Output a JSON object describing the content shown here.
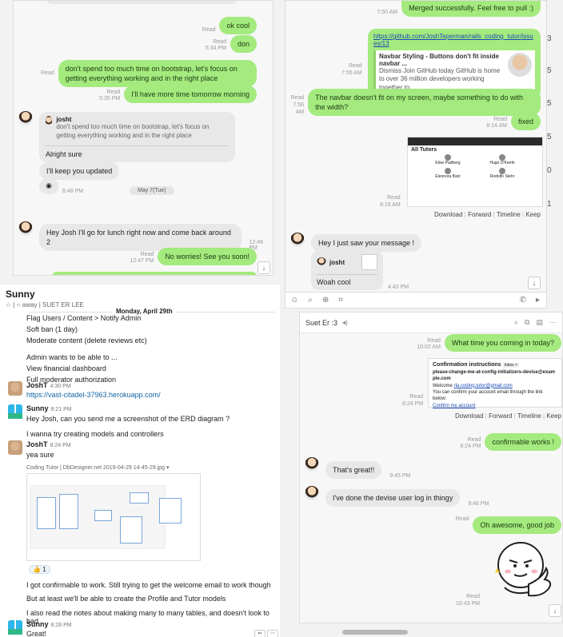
{
  "w1": {
    "msgs": [
      {
        "meta": "Read",
        "text": "ok cool"
      },
      {
        "meta": "Read",
        "time": "5:34 PM",
        "text": "don"
      },
      {
        "meta": "Read",
        "text": "don't spend too much time on bootstrap, let's focus on getting everything working and in the right place"
      },
      {
        "meta": "Read",
        "time": "5:35 PM",
        "text": "I'll have more time tomorrow morning"
      }
    ],
    "quote_author": "josht",
    "quote_text": "don't spend too much time on bootstrap, let's focus on getting everything working and in the right place",
    "reply": "Alright sure",
    "keep": "I'll keep you updated",
    "time1": "8:48 PM",
    "date": "May 7(Tue)",
    "lunch": "Hey Josh I'll go for lunch right now and come back around 2",
    "lunch_time": "12:46 PM",
    "worries_meta": "Read",
    "worries_time": "12:47 PM",
    "worries": "No worries! See you soon!",
    "down": "↓"
  },
  "w2": {
    "top_time": "7:50 AM",
    "top_text": "Merged successfully. Feel free to pull :)",
    "link": "https://github.com/JoshTeperman/rails_coding_tutor/issues/13",
    "card_title": "Navbar Styling - Buttons don't fit inside navbar ...",
    "card_desc": "Dismiss Join GitHub today GitHub is home to over 36 million developers working together to ...",
    "card_meta": "Read",
    "card_time": "7:55 AM",
    "navbar_meta": "Read",
    "navbar_time": "7:56 AM",
    "navbar_text": "The navbar doesn't fit on my screen, maybe something to do with the width?",
    "fixed_meta": "Read",
    "fixed_time": "8:14 AM",
    "fixed_text": "fixed",
    "img_meta": "Read",
    "img_time": "8:16 AM",
    "shot_heading": "All Tutors",
    "tutors": [
      "Elise Padberg",
      "Hugo O'Keefe",
      "Eleonora Batz",
      "Rodolfo Stehr"
    ],
    "actions": [
      "Download",
      "Forward",
      "Timeline",
      "Keep"
    ],
    "hey": "Hey I just saw your message !",
    "quote_author": "josht",
    "woah": "Woah cool",
    "woah_time": "4:43 PM",
    "edge_numbers": [
      "3",
      "5",
      "5",
      "5",
      "0",
      "1"
    ]
  },
  "slack": {
    "channel": "Sunny",
    "status": "away",
    "member": "SUET ER LEE",
    "date": "Monday, April 29th",
    "lines1": [
      "Flag Users / Content > Notify Admin",
      "Soft ban (1 day)",
      "Moderate content (delete reviews etc)"
    ],
    "lines2": [
      "Admin wants to be able to ...",
      "View financial dashboard",
      "Full moderator authorization"
    ],
    "m1_name": "JoshT",
    "m1_time": "4:30 PM",
    "m1_link": "https://vast-citadel-37963.herokuapp.com/",
    "m2_name": "Sunny",
    "m2_time": "8:21 PM",
    "m2_text": "Hey Josh, can you send me a screenshot of the ERD diagram ?",
    "m2_text2": "I wanna try creating models and controllers",
    "m3_name": "JoshT",
    "m3_time": "8:24 PM",
    "m3_text": "yea sure",
    "file_title": "Coding Tutor | DbDesigner.net 2019-04-29 14-45-29.jpg",
    "reaction_count": "1",
    "after": [
      "I got confirmable to work. Still trying to get the welcome email to work though",
      "But at least we'll be able to create the Profile and Tutor models",
      "I also read the notes about making many to many tables, and doesn't look to bad"
    ],
    "m4_name": "Sunny",
    "m4_time": "8:28 PM",
    "m4_text": "Great!"
  },
  "w3": {
    "title": "Suet Er :3",
    "msg1_meta": "Read",
    "msg1_time": "10:02 AM",
    "msg1": "What time you coming in today?",
    "email_title": "Confirmation instructions",
    "email_badge": "Inbox ×",
    "email_from": "please-change-me-at-config-initializers-devise@example.com",
    "email_welcome": "Welcome",
    "email_addr": "rla.coding.tutor@gmail.com",
    "email_body": "You can confirm your account email through the link below:",
    "email_link": "Confirm my account",
    "email_meta": "Read",
    "email_time": "8:24 PM",
    "actions": [
      "Download",
      "Forward",
      "Timeline",
      "Keep"
    ],
    "conf_meta": "Read",
    "conf_time": "8:24 PM",
    "conf": "confirmable works !",
    "great": "That's great!!",
    "great_time": "9:45 PM",
    "devise": "I've done the devise user log in thingy",
    "devise_time": "9:46 PM",
    "awesome_meta": "Read",
    "awesome": "Oh awesome, good job",
    "sticker_meta": "Read",
    "sticker_time": "10:43 PM",
    "down": "↓"
  }
}
